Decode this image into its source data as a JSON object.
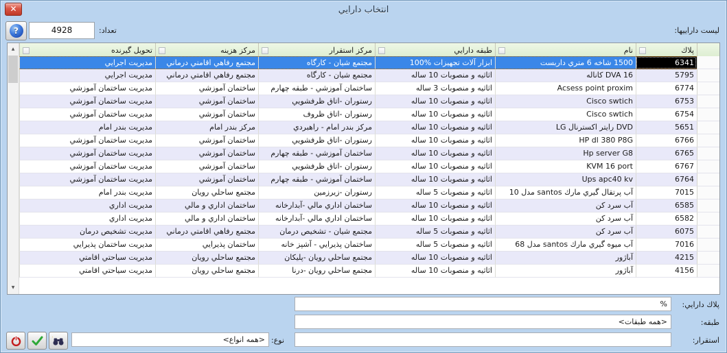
{
  "window": {
    "title": "انتخاب دارايي",
    "close_glyph": "✕"
  },
  "toolbar": {
    "list_label": "ليست داراييها:",
    "count_label": "تعداد:",
    "count_value": "4928",
    "help_icon": "?"
  },
  "table": {
    "selected_index": 0,
    "columns": [
      {
        "key": "plak",
        "label": "پلاك"
      },
      {
        "key": "name",
        "label": "نام"
      },
      {
        "key": "class",
        "label": "طبقه دارايي"
      },
      {
        "key": "deploy",
        "label": "مرکز استقرار"
      },
      {
        "key": "cost",
        "label": "مرکز هزينه"
      },
      {
        "key": "receiver",
        "label": "تحويل گيرنده"
      }
    ],
    "rows": [
      {
        "plak": "6341",
        "name": "1500 شاخه 6 متري داربست",
        "class": "ابزار آلات تجهيزات %100",
        "deploy": "مجتمع شيان - کارگاه",
        "cost": "مجتمع رفاهي اقامتي درماني",
        "receiver": "مديريت اجرايي"
      },
      {
        "plak": "5795",
        "name": "DVA 16 کاناله",
        "class": "اثاثيه و منصوبات 10 ساله",
        "deploy": "مجتمع شيان - کارگاه",
        "cost": "مجتمع رفاهي اقامتي درماني",
        "receiver": "مديريت اجرايي"
      },
      {
        "plak": "6774",
        "name": "Acsess point proxim",
        "class": "اثاثيه و منصوبات 3 ساله",
        "deploy": "ساختمان آموزشي - طبقه چهارم",
        "cost": "ساختمان آموزشي",
        "receiver": "مديريت ساختمان آموزشي"
      },
      {
        "plak": "6753",
        "name": "Cisco swtich",
        "class": "اثاثيه و منصوبات 10 ساله",
        "deploy": "رستوران -اتاق ظرفشويي",
        "cost": "ساختمان آموزشي",
        "receiver": "مديريت ساختمان آموزشي"
      },
      {
        "plak": "6754",
        "name": "Cisco swtich",
        "class": "اثاثيه و منصوبات 10 ساله",
        "deploy": "رستوران -اتاق ظروف",
        "cost": "ساختمان آموزشي",
        "receiver": "مديريت ساختمان آموزشي"
      },
      {
        "plak": "5651",
        "name": "DVD رايتر اکسترنال LG",
        "class": "اثاثيه و منصوبات 10 ساله",
        "deploy": "مرکز بندر امام - راهبردي",
        "cost": "مرکز بندر امام",
        "receiver": "مديريت بندر امام"
      },
      {
        "plak": "6766",
        "name": "HP dl 380 P8G",
        "class": "اثاثيه و منصوبات 10 ساله",
        "deploy": "رستوران -اتاق ظرفشويي",
        "cost": "ساختمان آموزشي",
        "receiver": "مديريت ساختمان آموزشي"
      },
      {
        "plak": "6765",
        "name": "Hp server G8",
        "class": "اثاثيه و منصوبات 10 ساله",
        "deploy": "ساختمان آموزشي - طبقه چهارم",
        "cost": "ساختمان آموزشي",
        "receiver": "مديريت ساختمان آموزشي"
      },
      {
        "plak": "6767",
        "name": "KVM 16 port",
        "class": "اثاثيه و منصوبات 10 ساله",
        "deploy": "رستوران -اتاق ظرفشويي",
        "cost": "ساختمان آموزشي",
        "receiver": "مديريت ساختمان آموزشي"
      },
      {
        "plak": "6764",
        "name": "Ups apc40 kv",
        "class": "اثاثيه و منصوبات 10 ساله",
        "deploy": "ساختمان آموزشي - طبقه چهارم",
        "cost": "ساختمان آموزشي",
        "receiver": "مديريت ساختمان آموزشي"
      },
      {
        "plak": "7015",
        "name": "آب پرتقال گيري مارك santos مدل 10",
        "class": "اثاثيه و منصوبات 5 ساله",
        "deploy": "رستوران -زيرزمين",
        "cost": "مجتمع ساحلي رويان",
        "receiver": "مديريت بندر امام"
      },
      {
        "plak": "6585",
        "name": "آب سرد کن",
        "class": "اثاثيه و منصوبات 10 ساله",
        "deploy": "ساختمان اداري مالي -آبدارخانه",
        "cost": "ساختمان اداري و مالي",
        "receiver": "مديريت اداري"
      },
      {
        "plak": "6582",
        "name": "آب سرد کن",
        "class": "اثاثيه و منصوبات 10 ساله",
        "deploy": "ساختمان اداري مالي -آبدارخانه",
        "cost": "ساختمان اداري و مالي",
        "receiver": "مديريت اداري"
      },
      {
        "plak": "6075",
        "name": "آب سرد کن",
        "class": "اثاثيه و منصوبات 5 ساله",
        "deploy": "مجتمع شيان - تشخيص درمان",
        "cost": "مجتمع رفاهي اقامتي درماني",
        "receiver": "مديريت تشخيص درمان"
      },
      {
        "plak": "7016",
        "name": "آب ميوه گيري مارك santos مدل 68",
        "class": "اثاثيه و منصوبات 5 ساله",
        "deploy": "ساختمان پذيرايي - آشپز خانه",
        "cost": "ساختمان پذيرايي",
        "receiver": "مديريت ساختمان پذيرايي"
      },
      {
        "plak": "4215",
        "name": "آباژور",
        "class": "اثاثيه و منصوبات 10 ساله",
        "deploy": "مجتمع ساحلي رويان -پليکان",
        "cost": "مجتمع ساحلي رويان",
        "receiver": "مديريت سياحتي اقامتي"
      },
      {
        "plak": "4156",
        "name": "آباژور",
        "class": "اثاثيه و منصوبات 10 ساله",
        "deploy": "مجتمع ساحلي رويان -درنا",
        "cost": "مجتمع ساحلي رويان",
        "receiver": "مديريت سياحتي اقامتي"
      }
    ]
  },
  "filters": {
    "plak_label": "پلاك دارايي:",
    "plak_value": "%",
    "class_label": "طبقه:",
    "class_value": "<همه طبقات>",
    "deploy_label": "استقرار:",
    "deploy_value": "",
    "type_label": "نوع:",
    "type_value": "<همه انواع>"
  },
  "colors": {
    "titlebar": "#bad4ef",
    "selection": "#3a87e8",
    "header_bg": "#dcedd0",
    "row_alt": "#e9e9f9",
    "close_red": "#d95545"
  }
}
